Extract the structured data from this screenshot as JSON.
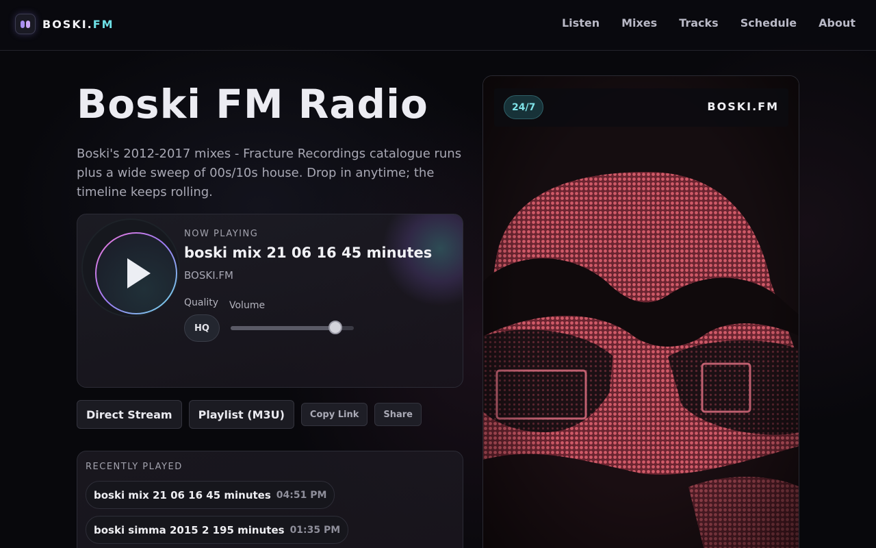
{
  "header": {
    "logo_text": "BOSKI.",
    "logo_accent": "FM",
    "nav": [
      "Listen",
      "Mixes",
      "Tracks",
      "Schedule",
      "About"
    ]
  },
  "hero": {
    "title": "Boski FM Radio",
    "description": "Boski's 2012-2017 mixes - Fracture Recordings catalogue runs plus a wide sweep of 00s/10s house. Drop in anytime; the timeline keeps rolling."
  },
  "player": {
    "now_playing_label": "NOW PLAYING",
    "track_title": "boski mix 21 06 16 45 minutes",
    "station": "BOSKI.FM",
    "quality_label": "Quality",
    "quality_value": "HQ",
    "volume_label": "Volume",
    "volume_level": 0.85
  },
  "actions": {
    "direct_stream": "Direct Stream",
    "playlist": "Playlist (M3U)",
    "copy_link": "Copy Link",
    "share": "Share"
  },
  "recent": {
    "label": "RECENTLY PLAYED",
    "items": [
      {
        "title": "boski mix 21 06 16 45 minutes",
        "time": "04:51 PM"
      },
      {
        "title": "boski simma 2015 2 195 minutes",
        "time": "01:35 PM"
      }
    ]
  },
  "art": {
    "badge": "24/7",
    "brand": "BOSKI.FM"
  },
  "colors": {
    "accent_cyan": "#6ee0e6",
    "accent_purple": "#9d7cf5",
    "accent_pink": "#f07ad8",
    "art_red": "#c84a58"
  }
}
